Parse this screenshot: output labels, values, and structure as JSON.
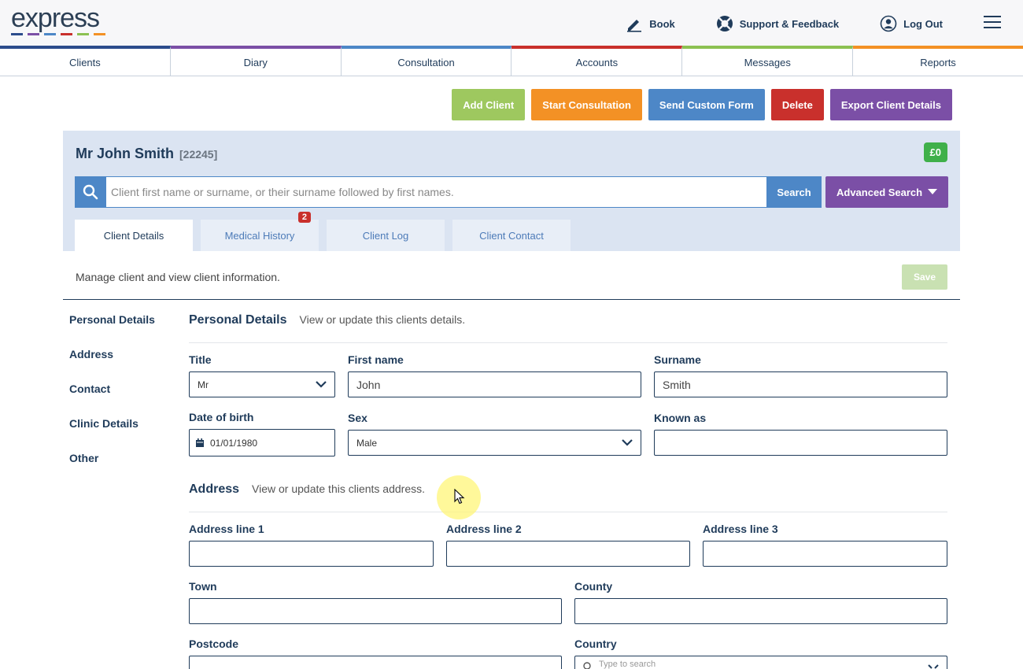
{
  "app": {
    "logo": "express",
    "logo_colors": [
      "#2c4c8c",
      "#7b4fa6",
      "#4d87c7",
      "#c9302c",
      "#8cc152",
      "#f39125"
    ]
  },
  "header": {
    "book": "Book",
    "support": "Support & Feedback",
    "logout": "Log Out"
  },
  "nav": [
    {
      "label": "Clients",
      "color": "#2c4c8c"
    },
    {
      "label": "Diary",
      "color": "#7b4fa6"
    },
    {
      "label": "Consultation",
      "color": "#4d87c7"
    },
    {
      "label": "Accounts",
      "color": "#c9302c"
    },
    {
      "label": "Messages",
      "color": "#8cc152"
    },
    {
      "label": "Reports",
      "color": "#f39125"
    }
  ],
  "actions": [
    {
      "label": "Add Client",
      "color": "#9ec85f"
    },
    {
      "label": "Start Consultation",
      "color": "#f39125"
    },
    {
      "label": "Send Custom Form",
      "color": "#4d87c7"
    },
    {
      "label": "Delete",
      "color": "#c9302c"
    },
    {
      "label": "Export Client Details",
      "color": "#7b4fa6"
    }
  ],
  "client": {
    "name": "Mr John Smith",
    "id": "[22245]",
    "balance": "£0"
  },
  "search": {
    "placeholder": "Client first name or surname, or their surname followed by first names.",
    "button": "Search",
    "advanced": "Advanced Search"
  },
  "subtabs": [
    {
      "label": "Client Details"
    },
    {
      "label": "Medical History",
      "badge": "2"
    },
    {
      "label": "Client Log"
    },
    {
      "label": "Client Contact"
    }
  ],
  "info": {
    "text": "Manage client and view client information.",
    "save": "Save"
  },
  "sidenav": [
    "Personal Details",
    "Address",
    "Contact",
    "Clinic Details",
    "Other"
  ],
  "personal": {
    "title": "Personal Details",
    "subtitle": "View or update this clients details.",
    "title_label": "Title",
    "title_value": "Mr",
    "first_label": "First name",
    "first_value": "John",
    "surname_label": "Surname",
    "surname_value": "Smith",
    "dob_label": "Date of birth",
    "dob_value": "01/01/1980",
    "sex_label": "Sex",
    "sex_value": "Male",
    "known_label": "Known as",
    "known_value": ""
  },
  "address": {
    "title": "Address",
    "subtitle": "View or update this clients address.",
    "line1": "Address line 1",
    "line2": "Address line 2",
    "line3": "Address line 3",
    "town": "Town",
    "county": "County",
    "postcode": "Postcode",
    "country": "Country",
    "country_placeholder": "Type to search"
  }
}
